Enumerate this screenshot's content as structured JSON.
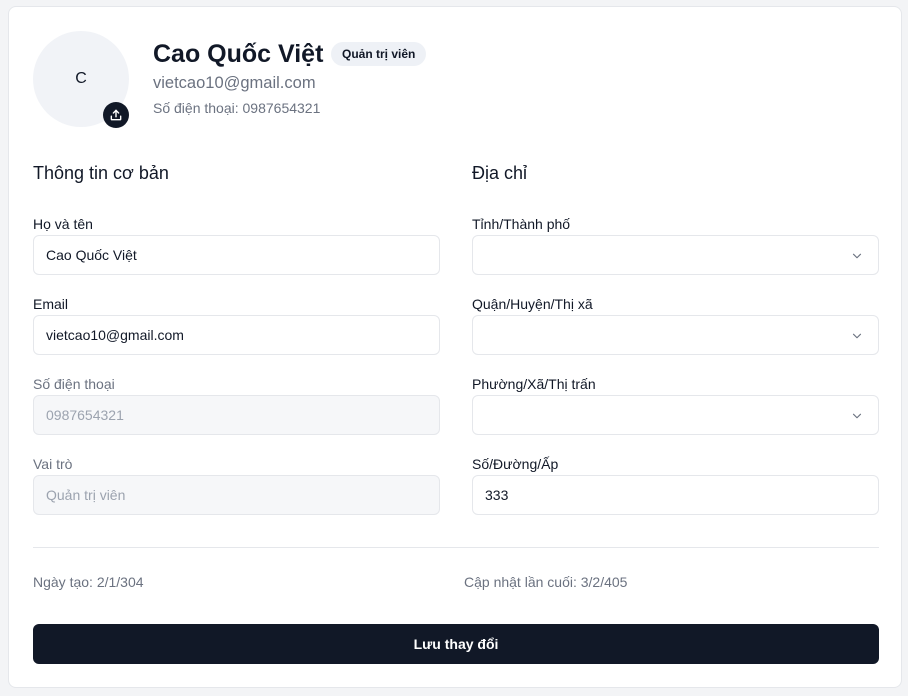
{
  "profile": {
    "avatar_initial": "C",
    "name": "Cao Quốc Việt",
    "role_badge": "Quản trị viên",
    "email": "vietcao10@gmail.com",
    "phone_line": "Số điện thoại: 0987654321"
  },
  "basic_info": {
    "title": "Thông tin cơ bản",
    "full_name": {
      "label": "Họ và tên",
      "value": "Cao Quốc Việt"
    },
    "email": {
      "label": "Email",
      "value": "vietcao10@gmail.com"
    },
    "phone": {
      "label": "Số điện thoại",
      "value": "0987654321"
    },
    "role": {
      "label": "Vai trò",
      "value": "Quản trị viên"
    }
  },
  "address": {
    "title": "Địa chỉ",
    "province": {
      "label": "Tỉnh/Thành phố",
      "value": ""
    },
    "district": {
      "label": "Quận/Huyện/Thị xã",
      "value": ""
    },
    "ward": {
      "label": "Phường/Xã/Thị trấn",
      "value": ""
    },
    "street": {
      "label": "Số/Đường/Ấp",
      "value": "333"
    }
  },
  "meta": {
    "created": "Ngày tạo: 2/1/304",
    "updated": "Cập nhật lần cuối: 3/2/405"
  },
  "actions": {
    "save_label": "Lưu thay đổi"
  },
  "colors": {
    "primary": "#111827",
    "muted_text": "#6b7280",
    "border": "#e5e7eb",
    "avatar_bg": "#f1f3f7"
  }
}
